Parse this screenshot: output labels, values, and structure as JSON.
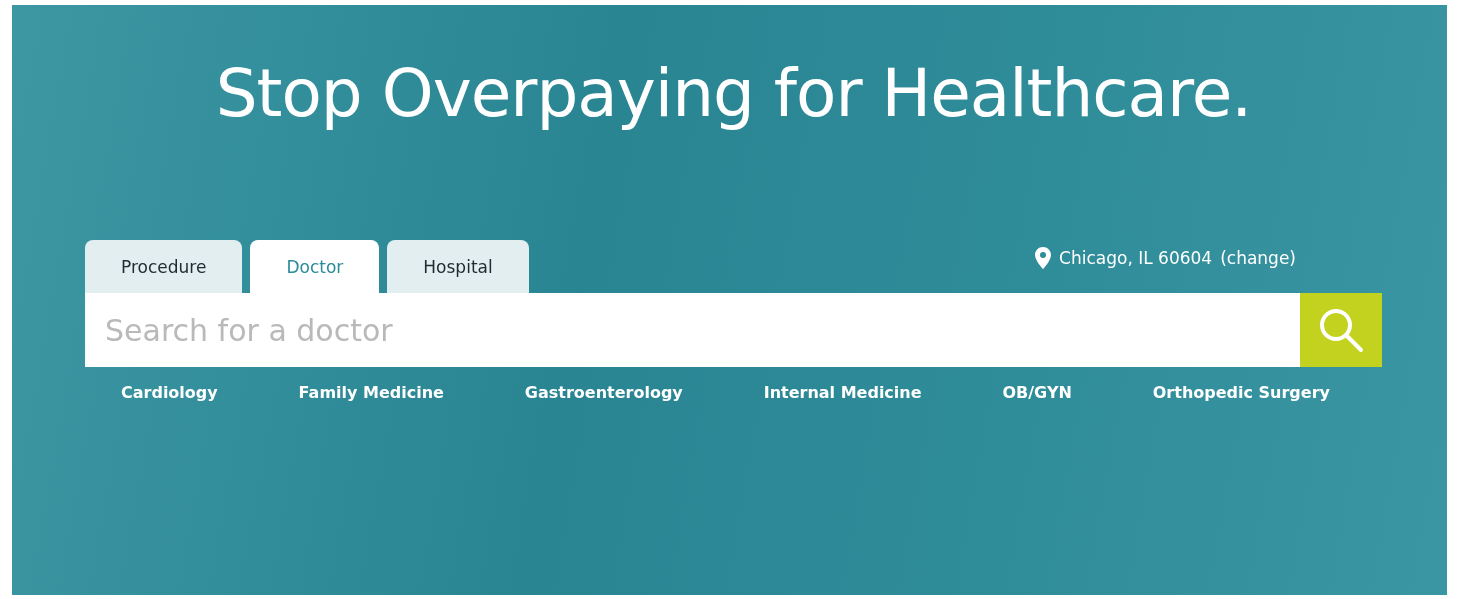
{
  "headline": "Stop Overpaying for Healthcare.",
  "tabs": [
    {
      "label": "Procedure",
      "selected": false
    },
    {
      "label": "Doctor",
      "selected": true
    },
    {
      "label": "Hospital",
      "selected": false
    }
  ],
  "location": {
    "text": "Chicago, IL 60604",
    "change_link": "(change)"
  },
  "search": {
    "placeholder": "Search for a doctor"
  },
  "specialties": [
    "Cardiology",
    "Family Medicine",
    "Gastroenterology",
    "Internal Medicine",
    "OB/GYN",
    "Orthopedic Surgery"
  ]
}
